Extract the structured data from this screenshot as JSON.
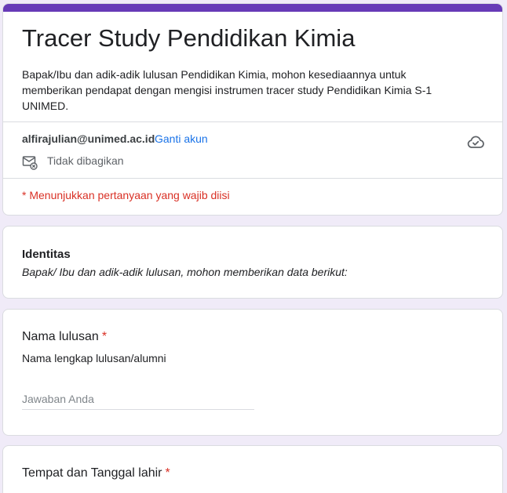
{
  "header": {
    "accent_color": "#673ab7",
    "title": "Tracer Study Pendidikan Kimia",
    "description": "Bapak/Ibu dan adik-adik lulusan Pendidikan Kimia, mohon kesediaannya untuk memberikan pendapat dengan mengisi instrumen tracer study Pendidikan Kimia S-1 UNIMED."
  },
  "account": {
    "email": "alfirajulian@unimed.ac.id",
    "switch_label": "Ganti akun",
    "share_status": "Tidak dibagikan",
    "cloud_icon": "cloud-check-icon",
    "share_icon": "mail-off-icon"
  },
  "required_note": "* Menunjukkan pertanyaan yang wajib diisi",
  "section": {
    "title": "Identitas",
    "description": "Bapak/ Ibu dan adik-adik lulusan, mohon memberikan data berikut:"
  },
  "questions": [
    {
      "title": "Nama lulusan",
      "required_mark": "*",
      "help": "Nama lengkap lulusan/alumni",
      "placeholder": "Jawaban Anda"
    },
    {
      "title": "Tempat dan Tanggal lahir",
      "required_mark": "*"
    }
  ],
  "colors": {
    "background": "#f0ebf8",
    "required": "#d93025",
    "link": "#1a73e8"
  }
}
